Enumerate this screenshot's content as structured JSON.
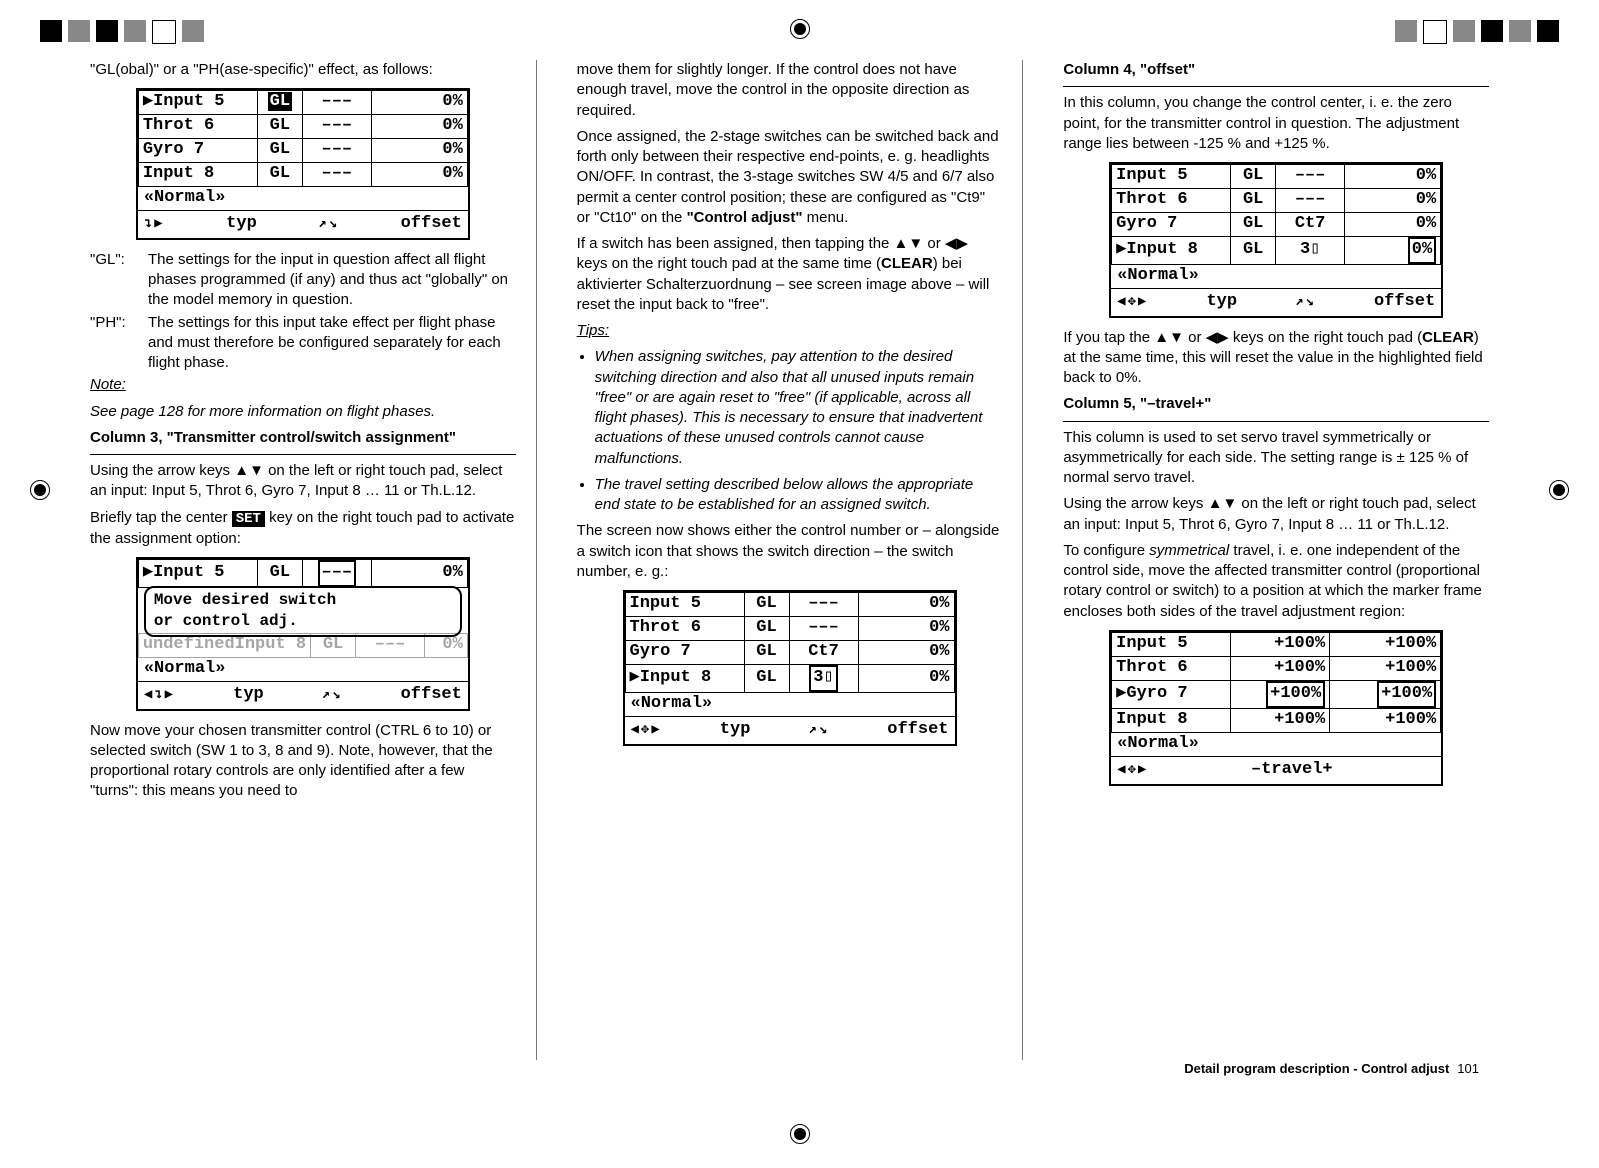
{
  "crop_icon": "⊕",
  "col1": {
    "intro": "\"GL(obal)\" or a \"PH(ase-specific)\" effect, as follows:",
    "lcd1": {
      "rows": [
        {
          "ptr": "▶",
          "name": "Input  5",
          "mode": "GL",
          "mid": "–––",
          "val": "0%",
          "sel": "mode"
        },
        {
          "ptr": "",
          "name": "Throt 6",
          "mode": "GL",
          "mid": "–––",
          "val": "0%"
        },
        {
          "ptr": "",
          "name": "Gyro  7",
          "mode": "GL",
          "mid": "–––",
          "val": "0%"
        },
        {
          "ptr": "",
          "name": "Input  8",
          "mode": "GL",
          "mid": "–––",
          "val": "0%"
        }
      ],
      "phase": "«Normal»",
      "bar": {
        "l": "↴▶",
        "c": "typ",
        "m": "↗↘",
        "r": "offset"
      }
    },
    "gl_label": "\"GL\":",
    "gl_text": "The settings for the input in question affect all flight phases programmed (if any) and thus act \"globally\" on the model memory in question.",
    "ph_label": "\"PH\":",
    "ph_text": "The settings for this input take effect per flight phase and must therefore be configured separately for each flight phase.",
    "note_label": "Note:",
    "note_text": "See page 128 for more information on flight phases.",
    "h3": "Column 3, \"Transmitter control/switch assignment\"",
    "p1a": "Using the arrow keys ▲▼ on the left or right touch pad, select an input: Input 5, Throt 6, Gyro 7, Input 8 … 11 or Th.L.12.",
    "p1b_a": "Briefly tap the center ",
    "p1b_set": "SET",
    "p1b_b": " key on the right touch pad to activate the assignment option:",
    "lcd2": {
      "row": {
        "ptr": "▶",
        "name": "Input  5",
        "mode": "GL",
        "mid": "–––",
        "val": "0%",
        "selMid": true
      },
      "dialog_l1": "Move  desired  switch",
      "dialog_l2": "or  control  adj.",
      "ghost": {
        "name": "Input  8",
        "mode": "GL",
        "mid": "–––",
        "val": "0%"
      },
      "phase": "«Normal»",
      "bar": {
        "l": "◀↴▶",
        "c": "typ",
        "m": "↗↘",
        "r": "offset"
      }
    },
    "p2": "Now move your chosen transmitter control (CTRL 6 to 10) or selected switch (SW 1 to 3, 8 and 9). Note, however, that the proportional rotary controls are only identified after a few \"turns\": this means you need to"
  },
  "col2": {
    "p1": "move them for slightly longer. If the control does not have enough travel, move the control in the opposite direction as required.",
    "p2_a": "Once assigned, the 2-stage switches can be switched back and forth only between their respective end-points, e. g. headlights ON/OFF. In contrast, the 3-stage switches SW 4/5 and 6/7 also permit a center control position; these are configured as \"Ct9\" or \"Ct10\" on the ",
    "p2_menu": "\"Control adjust\"",
    "p2_b": " menu.",
    "p3_a": "If a switch has been assigned, then tapping the ▲▼ or ◀▶ keys on the right touch pad at the same time (",
    "p3_clear": "CLEAR",
    "p3_b": ") bei aktivierter Schalterzuordnung – see screen image above – will reset the input back to \"free\".",
    "tips_label": "Tips:",
    "tip1": "When assigning switches, pay attention to the desired switching direction and also that all unused inputs remain \"free\" or are again reset to \"free\" (if applicable, across all flight phases). This is necessary to ensure that inadvertent actuations of these unused controls cannot cause malfunctions.",
    "tip2": "The travel setting described below allows the appropriate end state to be established for an assigned switch.",
    "p4": "The screen now shows either the control number or – alongside a switch icon that shows the switch direction – the switch number, e. g.:",
    "lcd3": {
      "rows": [
        {
          "ptr": "",
          "name": "Input  5",
          "mode": "GL",
          "mid": "–––",
          "val": "0%"
        },
        {
          "ptr": "",
          "name": "Throt 6",
          "mode": "GL",
          "mid": "–––",
          "val": "0%"
        },
        {
          "ptr": "",
          "name": "Gyro  7",
          "mode": "GL",
          "mid": "Ct7",
          "val": "0%"
        },
        {
          "ptr": "▶",
          "name": "Input  8",
          "mode": "GL",
          "mid": " 3▯",
          "val": "0%",
          "selMid": true
        }
      ],
      "phase": "«Normal»",
      "bar": {
        "l": "◀✥▶",
        "c": "typ",
        "m": "↗↘",
        "r": "offset"
      }
    }
  },
  "col3": {
    "h4": "Column 4, \"offset\"",
    "p4": "In this column, you change the control center, i. e. the zero point, for the transmitter control in question. The adjustment range lies between -125 % and +125 %.",
    "lcd4": {
      "rows": [
        {
          "ptr": "",
          "name": "Input  5",
          "mode": "GL",
          "mid": "–––",
          "val": "0%"
        },
        {
          "ptr": "",
          "name": "Throt 6",
          "mode": "GL",
          "mid": "–––",
          "val": "0%"
        },
        {
          "ptr": "",
          "name": "Gyro  7",
          "mode": "GL",
          "mid": "Ct7",
          "val": "0%"
        },
        {
          "ptr": "▶",
          "name": "Input  8",
          "mode": "GL",
          "mid": " 3▯",
          "val": "0%",
          "selVal": true
        }
      ],
      "phase": "«Normal»",
      "bar": {
        "l": "◀✥▶",
        "c": "typ",
        "m": "↗↘",
        "r": "offset"
      }
    },
    "p4b_a": "If you tap the ▲▼ or ◀▶ keys on the right touch pad (",
    "p4b_clear": "CLEAR",
    "p4b_b": ") at the same time, this will reset the value in the highlighted field back to 0%.",
    "h5": "Column 5, \"–travel+\"",
    "p5a": "This column is used to set servo travel symmetrically or asymmetrically for each side. The setting range is ± 125 % of normal servo travel.",
    "p5b": "Using the arrow keys ▲▼ on the left or right touch pad, select an input: Input 5, Throt 6, Gyro 7, Input 8 … 11 or Th.L.12.",
    "p5c_a": "To configure ",
    "p5c_em": "symmetrical",
    "p5c_b": " travel, i. e. one independent of the control side, move the affected transmitter control (proportional rotary control or switch) to a position at which the marker frame encloses both sides of the travel adjustment region:",
    "lcd5": {
      "rows": [
        {
          "ptr": "",
          "name": "Input  5",
          "l": "+100%",
          "r": "+100%"
        },
        {
          "ptr": "",
          "name": "Throt 6",
          "l": "+100%",
          "r": "+100%"
        },
        {
          "ptr": "▶",
          "name": "Gyro  7",
          "l": "+100%",
          "r": "+100%",
          "selRow": true
        },
        {
          "ptr": "",
          "name": "Input  8",
          "l": "+100%",
          "r": "+100%"
        }
      ],
      "phase": "«Normal»",
      "bar": {
        "l": "◀✥▶",
        "c": "–travel+"
      }
    }
  },
  "footer": {
    "title": "Detail program description - Control adjust",
    "page": "101"
  }
}
